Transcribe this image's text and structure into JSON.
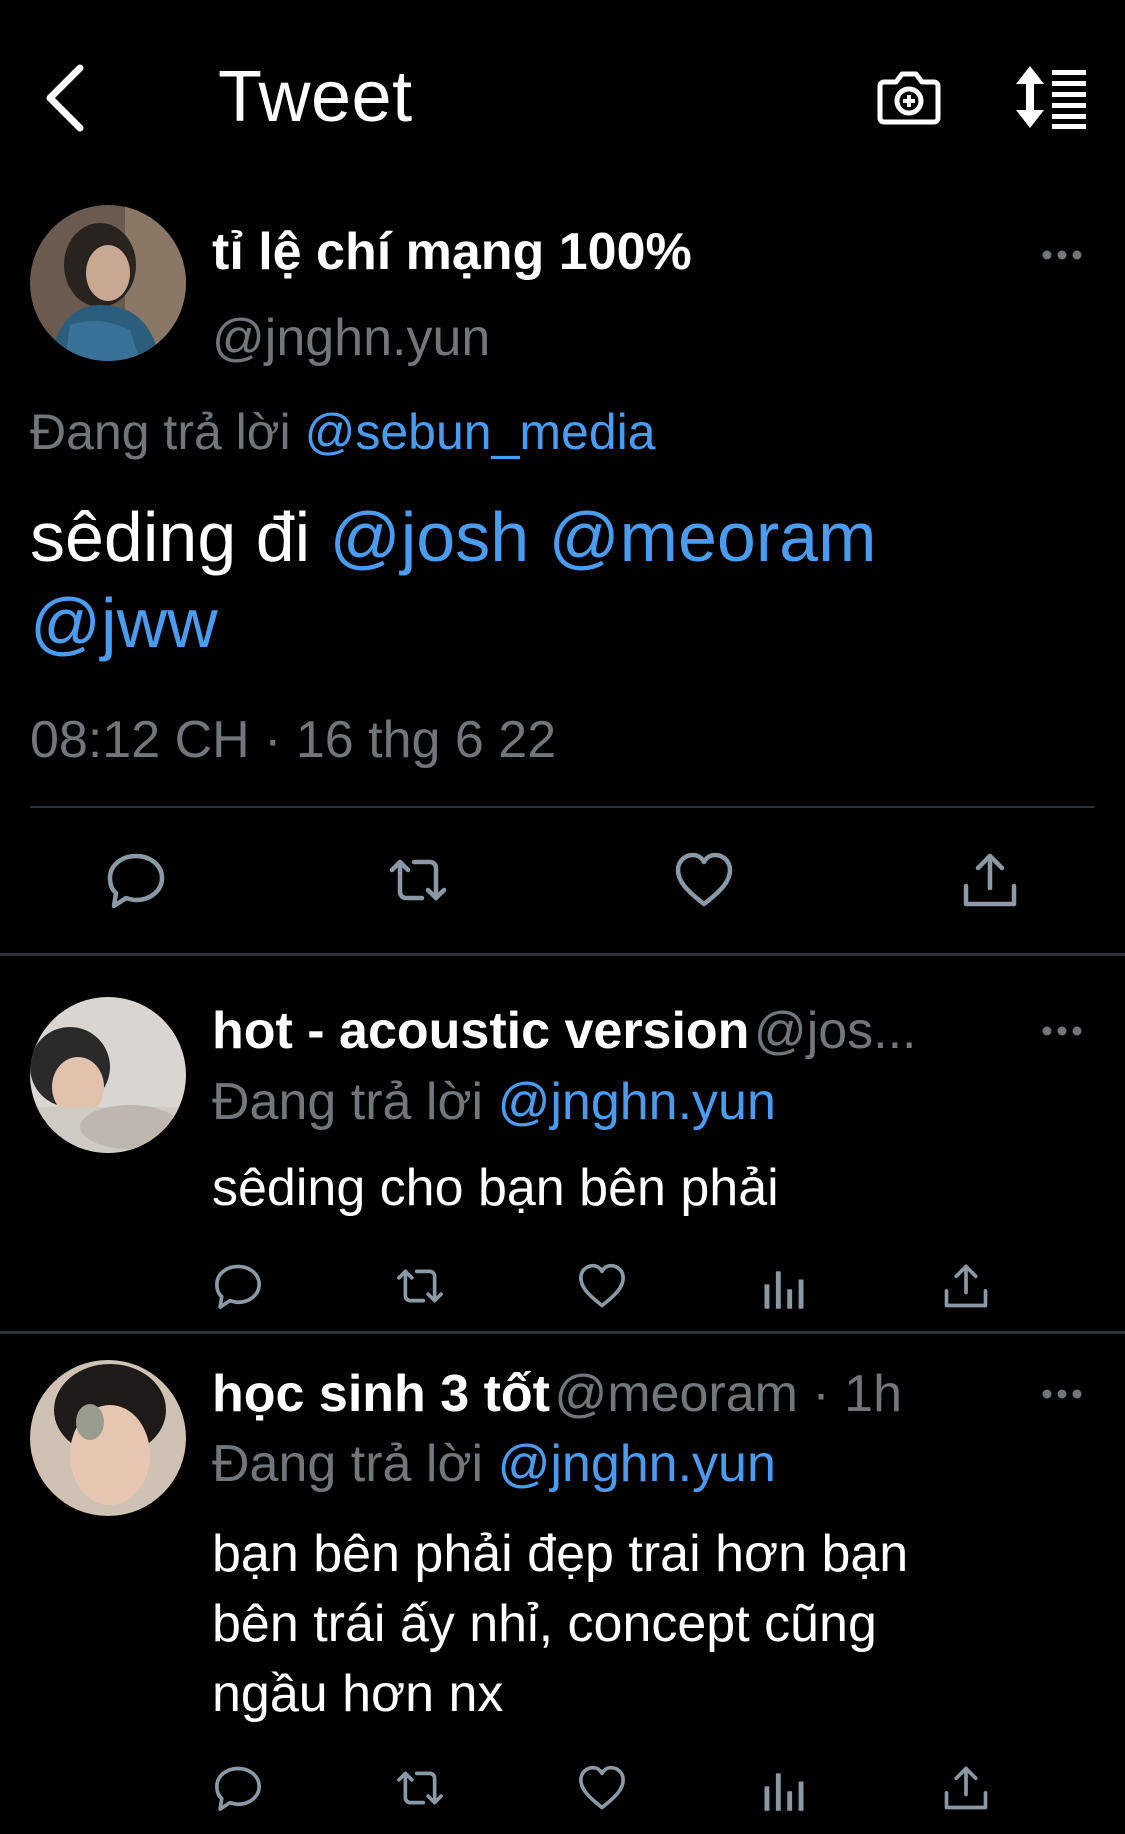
{
  "header": {
    "title": "Tweet"
  },
  "main_tweet": {
    "display_name": "tỉ lệ chí mạng 100%",
    "handle": "@jnghn.yun",
    "replying_prefix": "Đang trả lời",
    "replying_to": "@sebun_media",
    "text_plain": "sêding đi",
    "mentions": [
      "@josh",
      "@meoram",
      "@jww"
    ],
    "timestamp": "08:12 CH · 16 thg 6 22"
  },
  "replies": [
    {
      "display_name": "hot - acoustic version",
      "handle_meta": "@jos...",
      "replying_prefix": "Đang trả lời",
      "replying_to": "@jnghn.yun",
      "text": "sêding cho bạn bên phải"
    },
    {
      "display_name": "học sinh 3 tốt",
      "handle_meta": "@meoram · 1h",
      "replying_prefix": "Đang trả lời",
      "replying_to": "@jnghn.yun",
      "text_lines": [
        "bạn bên phải đẹp trai hơn bạn",
        "bên trái ấy nhỉ, concept cũng",
        "ngầu hơn nx"
      ]
    }
  ],
  "colors": {
    "background": "#000000",
    "link": "#4a9cf0",
    "secondary": "#71767b",
    "divider": "#2f3336"
  },
  "icons": [
    "back-arrow-icon",
    "camera-plus-icon",
    "sort-icon",
    "more-icon",
    "reply-icon",
    "retweet-icon",
    "like-icon",
    "analytics-icon",
    "share-icon"
  ]
}
